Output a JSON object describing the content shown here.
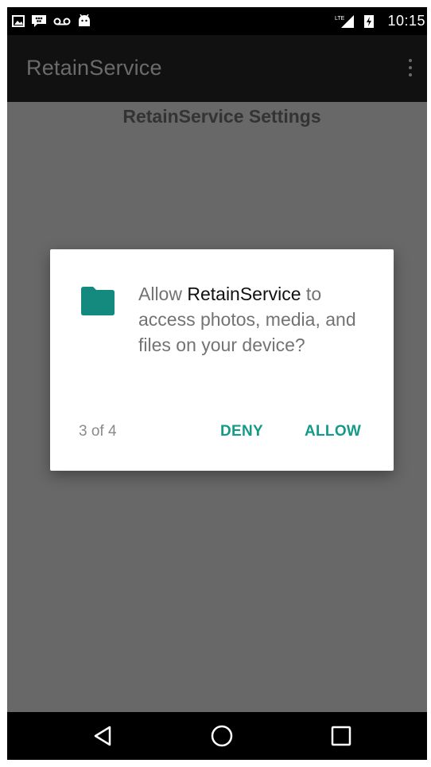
{
  "status_bar": {
    "time": "10:15",
    "icons": [
      "image-icon",
      "blackberry-icon",
      "voicemail-icon",
      "android-icon",
      "signal-icon",
      "battery-icon"
    ]
  },
  "toolbar": {
    "title": "RetainService",
    "menu_icon": "overflow-menu-icon"
  },
  "content": {
    "heading": "RetainService Settings"
  },
  "dialog": {
    "icon": "folder-icon",
    "message_prefix": "Allow ",
    "app_name": "RetainService",
    "message_suffix": " to access photos, media, and files on your device?",
    "step": "3 of 4",
    "deny_label": "DENY",
    "allow_label": "ALLOW",
    "accent_color": "#149a8a"
  },
  "nav_bar": {
    "buttons": [
      "back-icon",
      "home-icon",
      "recents-icon"
    ]
  }
}
